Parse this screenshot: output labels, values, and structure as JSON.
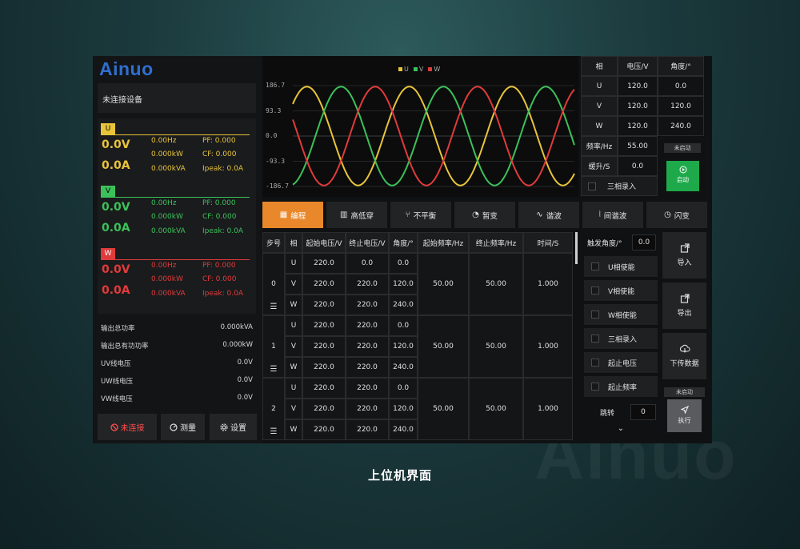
{
  "brand": "Ainuo",
  "caption": "上位机界面",
  "left": {
    "device_status": "未连接设备",
    "phases": [
      {
        "name": "U",
        "color": "#e8c43a",
        "voltage": "0.0V",
        "current": "0.0A",
        "freq": "0.00Hz",
        "kw": "0.000kW",
        "kva": "0.000kVA",
        "pf": "PF: 0.000",
        "cf": "CF: 0.000",
        "ipeak": "Ipeak: 0.0A"
      },
      {
        "name": "V",
        "color": "#3cc15a",
        "voltage": "0.0V",
        "current": "0.0A",
        "freq": "0.00Hz",
        "kw": "0.000kW",
        "kva": "0.000kVA",
        "pf": "PF: 0.000",
        "cf": "CF: 0.000",
        "ipeak": "Ipeak: 0.0A"
      },
      {
        "name": "W",
        "color": "#e03b3b",
        "voltage": "0.0V",
        "current": "0.0A",
        "freq": "0.00Hz",
        "kw": "0.000kW",
        "kva": "0.000kVA",
        "pf": "PF: 0.000",
        "cf": "CF: 0.000",
        "ipeak": "Ipeak: 0.0A"
      }
    ],
    "totals": [
      {
        "label": "输出总功率",
        "value": "0.000kVA"
      },
      {
        "label": "输出总有功功率",
        "value": "0.000kW"
      },
      {
        "label": "UV线电压",
        "value": "0.0V"
      },
      {
        "label": "UW线电压",
        "value": "0.0V"
      },
      {
        "label": "VW线电压",
        "value": "0.0V"
      }
    ],
    "buttons": {
      "disconnect": "未连接",
      "measure": "测量",
      "settings": "设置"
    }
  },
  "graph": {
    "legend": [
      "U",
      "V",
      "W"
    ],
    "yticks": [
      "186.7",
      "93.3",
      "0.0",
      "-93.3",
      "-186.7"
    ],
    "colors": {
      "U": "#e8c43a",
      "V": "#3cc15a",
      "W": "#e03b3b"
    }
  },
  "phase_table": {
    "headers": [
      "相",
      "电压/V",
      "角度/°"
    ],
    "rows": [
      [
        "U",
        "120.0",
        "0.0"
      ],
      [
        "V",
        "120.0",
        "120.0"
      ],
      [
        "W",
        "120.0",
        "240.0"
      ]
    ],
    "freq_label": "频率/Hz",
    "freq_value": "55.00",
    "ramp_label": "缓升/S",
    "ramp_value": "0.0",
    "record_label": "三相录入",
    "status_badge": "未启动",
    "start_label": "启动"
  },
  "tabs": [
    "编程",
    "高低穿",
    "不平衡",
    "暂变",
    "谐波",
    "间谐波",
    "闪变"
  ],
  "program": {
    "headers": [
      "步号",
      "相",
      "起始电压/V",
      "终止电压/V",
      "角度/°",
      "起始频率/Hz",
      "终止频率/Hz",
      "时间/S"
    ],
    "steps": [
      {
        "step": "0",
        "start_freq": "50.00",
        "end_freq": "50.00",
        "time": "1.000",
        "rows": [
          [
            "U",
            "220.0",
            "0.0",
            "0.0"
          ],
          [
            "V",
            "220.0",
            "220.0",
            "120.0"
          ],
          [
            "W",
            "220.0",
            "220.0",
            "240.0"
          ]
        ]
      },
      {
        "step": "1",
        "start_freq": "50.00",
        "end_freq": "50.00",
        "time": "1.000",
        "rows": [
          [
            "U",
            "220.0",
            "220.0",
            "0.0"
          ],
          [
            "V",
            "220.0",
            "220.0",
            "120.0"
          ],
          [
            "W",
            "220.0",
            "220.0",
            "240.0"
          ]
        ]
      },
      {
        "step": "2",
        "start_freq": "50.00",
        "end_freq": "50.00",
        "time": "1.000",
        "rows": [
          [
            "U",
            "220.0",
            "220.0",
            "0.0"
          ],
          [
            "V",
            "220.0",
            "220.0",
            "120.0"
          ],
          [
            "W",
            "220.0",
            "220.0",
            "240.0"
          ]
        ]
      }
    ]
  },
  "right_panel": {
    "trigger_label": "触发角度/°",
    "trigger_value": "0.0",
    "checks": [
      "U相使能",
      "V相使能",
      "W相使能",
      "三相录入",
      "起止电压",
      "起止频率"
    ],
    "jump_label": "跳转",
    "jump_value": "0",
    "import_label": "导入",
    "export_label": "导出",
    "download_label": "下传数据",
    "status_badge": "未启动",
    "execute_label": "执行"
  }
}
